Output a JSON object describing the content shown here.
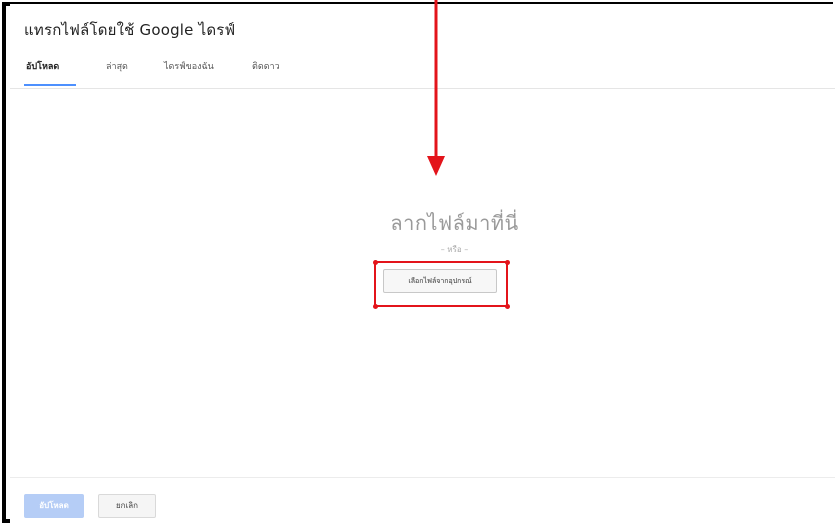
{
  "dialog": {
    "title": "แทรกไฟล์โดยใช้ Google ไดรฟ์"
  },
  "tabs": [
    {
      "label": "อัปโหลด",
      "active": true
    },
    {
      "label": "ล่าสุด",
      "active": false
    },
    {
      "label": "ไดรฟ์ของฉัน",
      "active": false
    },
    {
      "label": "ติดดาว",
      "active": false
    }
  ],
  "drop_zone": {
    "prompt": "ลากไฟล์มาที่นี่",
    "or_text": "– หรือ –",
    "select_button_label": "เลือกไฟล์จากอุปกรณ์"
  },
  "footer": {
    "upload_label": "อัปโหลด",
    "cancel_label": "ยกเลิก"
  },
  "colors": {
    "accent": "#4d90fe",
    "upload_disabled": "#b5cdf6",
    "annotation_red": "#e3141b",
    "frame_border": "#000000"
  }
}
